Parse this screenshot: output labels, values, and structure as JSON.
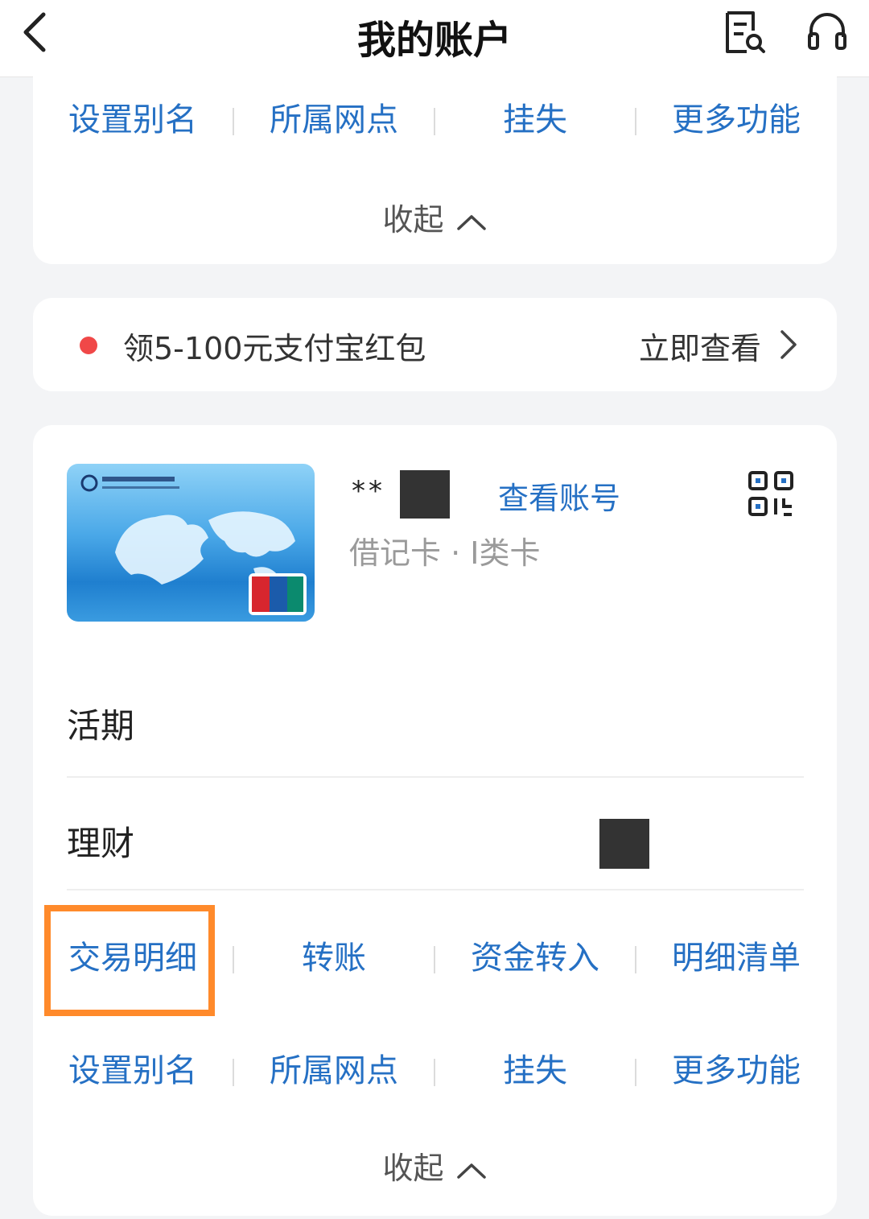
{
  "header": {
    "title": "我的账户",
    "back_icon": "chevron-left-icon",
    "bill_icon": "bill-search-icon",
    "service_icon": "headset-icon"
  },
  "top_card": {
    "actions": [
      "设置别名",
      "所属网点",
      "挂失",
      "更多功能"
    ],
    "collapse_label": "收起"
  },
  "promo": {
    "text": "领5-100元支付宝红包",
    "link": "立即查看",
    "dot_color": "#f04848"
  },
  "account_card": {
    "masked_name": "**",
    "view_account_label": "查看账号",
    "card_type": "借记卡 · I类卡",
    "bank_card_image": "bank-of-communications-unionpay-card",
    "qr_icon": "qr-code-icon",
    "sections": [
      "活期",
      "理财"
    ],
    "primary_actions": [
      "交易明细",
      "转账",
      "资金转入",
      "明细清单"
    ],
    "secondary_actions": [
      "设置别名",
      "所属网点",
      "挂失",
      "更多功能"
    ],
    "collapse_label": "收起",
    "highlighted_action": "交易明细"
  },
  "colors": {
    "accent_blue": "#2570c4",
    "highlight_orange": "#ff8a2b",
    "background": "#f3f4f6"
  }
}
